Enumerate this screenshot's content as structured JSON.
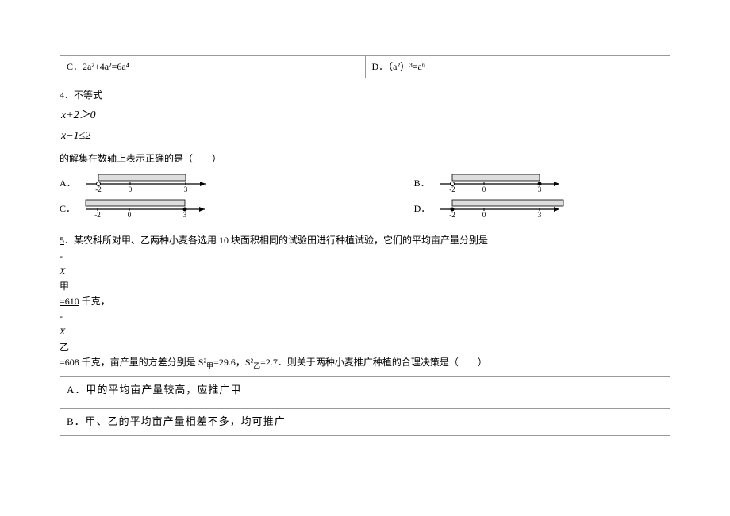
{
  "q3": {
    "optC": "C．2a²+4a²=6a⁴",
    "optD": "D．（a²）³=a⁶"
  },
  "q4": {
    "label": "4．不等式",
    "ineq1": "x+2＞0",
    "ineq2": "x−1≤2",
    "tail": "的解集在数轴上表示正确的是（　　）",
    "letters": {
      "A": "A．",
      "B": "B．",
      "C": "C．",
      "D": "D．"
    },
    "ticks": {
      "neg2": "-2",
      "zero": "0",
      "three": "3"
    }
  },
  "q5": {
    "label": "5",
    "lead": "．某农科所对甲、乙两种小麦各选用 10 块面积相同的试验田进行种植试验，它们的平均亩产量分别是",
    "bar": "-",
    "Xjia_x": "X",
    "Xjia_sub": "甲",
    "eq1_pref": "=610",
    "eq1_unit": " 千克，",
    "bar2": "-",
    "Xyi_x": "X",
    "Xyi_sub": "乙",
    "eq2": "=608 千克，亩产量的方差分别是 S²",
    "jia": "甲",
    "s1val": "=29.6，S²",
    "yi": "乙",
    "s2val": "=2.7．则关于两种小麦推广种植的合理决策是（　　）",
    "optA": "A．甲的平均亩产量较高，应推广甲",
    "optB": "B．甲、乙的平均亩产量相差不多，均可推广"
  }
}
